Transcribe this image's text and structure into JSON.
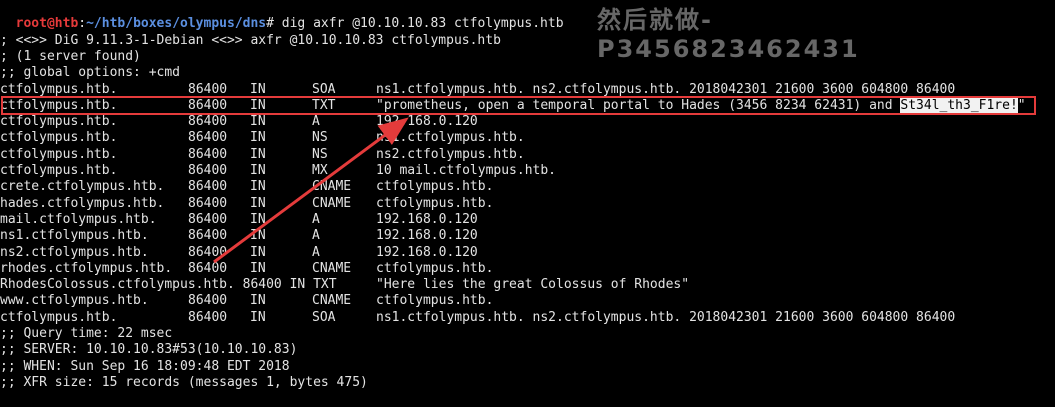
{
  "prompt": {
    "user_host": "root@htb",
    "sep": ":",
    "path": "~/htb/boxes/olympus/dns",
    "symbol": "#",
    "command": " dig axfr @10.10.10.83 ctfolympus.htb"
  },
  "watermark": "然后就做-P3456823462431",
  "header_lines": [
    "",
    "; <<>> DiG 9.11.3-1-Debian <<>> axfr @10.10.10.83 ctfolympus.htb",
    "; (1 server found)",
    ";; global options: +cmd"
  ],
  "records": [
    {
      "name": "ctfolympus.htb.",
      "ttl": "86400",
      "cls": "IN",
      "type": "SOA",
      "value": "ns1.ctfolympus.htb. ns2.ctfolympus.htb. 2018042301 21600 3600 604800 86400"
    },
    {
      "name": "ctfolympus.htb.",
      "ttl": "86400",
      "cls": "IN",
      "type": "TXT",
      "value": "\"prometheus, open a temporal portal to Hades (3456 8234 62431) and ",
      "value_hl": "St34l_th3_F1re!",
      "value_tail": "\""
    },
    {
      "name": "ctfolympus.htb.",
      "ttl": "86400",
      "cls": "IN",
      "type": "A",
      "value": "192.168.0.120"
    },
    {
      "name": "ctfolympus.htb.",
      "ttl": "86400",
      "cls": "IN",
      "type": "NS",
      "value": "ns1.ctfolympus.htb."
    },
    {
      "name": "ctfolympus.htb.",
      "ttl": "86400",
      "cls": "IN",
      "type": "NS",
      "value": "ns2.ctfolympus.htb."
    },
    {
      "name": "ctfolympus.htb.",
      "ttl": "86400",
      "cls": "IN",
      "type": "MX",
      "value": "10 mail.ctfolympus.htb."
    },
    {
      "name": "crete.ctfolympus.htb.",
      "ttl": "86400",
      "cls": "IN",
      "type": "CNAME",
      "value": "ctfolympus.htb."
    },
    {
      "name": "hades.ctfolympus.htb.",
      "ttl": "86400",
      "cls": "IN",
      "type": "CNAME",
      "value": "ctfolympus.htb."
    },
    {
      "name": "mail.ctfolympus.htb.",
      "ttl": "86400",
      "cls": "IN",
      "type": "A",
      "value": "192.168.0.120"
    },
    {
      "name": "ns1.ctfolympus.htb.",
      "ttl": "86400",
      "cls": "IN",
      "type": "A",
      "value": "192.168.0.120"
    },
    {
      "name": "ns2.ctfolympus.htb.",
      "ttl": "86400",
      "cls": "IN",
      "type": "A",
      "value": "192.168.0.120"
    },
    {
      "name": "rhodes.ctfolympus.htb.",
      "ttl": "86400",
      "cls": "IN",
      "type": "CNAME",
      "value": "ctfolympus.htb."
    },
    {
      "raw": "RhodesColossus.ctfolympus.htb. 86400 IN TXT",
      "value": "\"Here lies the great Colossus of Rhodes\""
    },
    {
      "name": "www.ctfolympus.htb.",
      "ttl": "86400",
      "cls": "IN",
      "type": "CNAME",
      "value": "ctfolympus.htb."
    },
    {
      "name": "ctfolympus.htb.",
      "ttl": "86400",
      "cls": "IN",
      "type": "SOA",
      "value": "ns1.ctfolympus.htb. ns2.ctfolympus.htb. 2018042301 21600 3600 604800 86400"
    }
  ],
  "footer_lines": [
    ";; Query time: 22 msec",
    ";; SERVER: 10.10.10.83#53(10.10.10.83)",
    ";; WHEN: Sun Sep 16 18:09:48 EDT 2018",
    ";; XFR size: 15 records (messages 1, bytes 475)"
  ],
  "colors": {
    "background": "#000000",
    "text": "#e3e3e3",
    "prompt_user": "#e63a3a",
    "prompt_path": "#5b8fe0",
    "annotation": "#e43b3b"
  }
}
